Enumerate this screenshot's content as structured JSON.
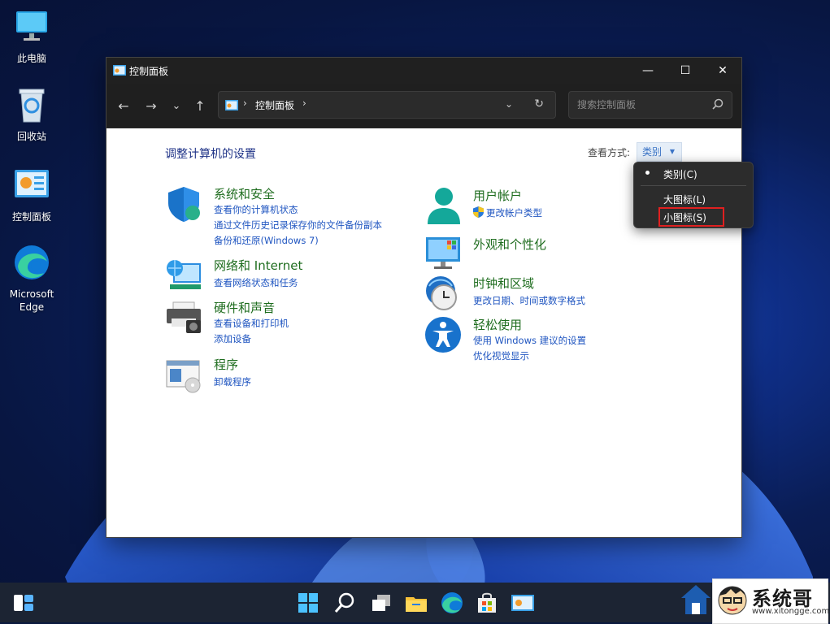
{
  "desktop": {
    "icons": [
      {
        "label": "此电脑"
      },
      {
        "label": "回收站"
      },
      {
        "label": "控制面板"
      },
      {
        "label": "Microsoft Edge"
      }
    ]
  },
  "window": {
    "title": "控制面板",
    "buttons": {
      "minimize": "—",
      "maximize": "☐",
      "close": "✕"
    },
    "nav": {
      "back": "←",
      "forward": "→",
      "recent": "⌄",
      "up": "↑"
    },
    "address": {
      "separator": "›",
      "path": "控制面板",
      "trailing": "›",
      "dropdown": "⌄",
      "refresh": "↻"
    },
    "search": {
      "placeholder": "搜索控制面板"
    }
  },
  "content": {
    "page_title": "调整计算机的设置",
    "view_by_label": "查看方式:",
    "view_by_value": "类别",
    "view_by_caret": "▼",
    "categories": [
      {
        "title": "系统和安全",
        "icon": "shield-icon",
        "links": [
          "查看你的计算机状态",
          "通过文件历史记录保存你的文件备份副本",
          "备份和还原(Windows 7)"
        ]
      },
      {
        "title": "网络和 Internet",
        "icon": "network-icon",
        "links": [
          "查看网络状态和任务"
        ]
      },
      {
        "title": "硬件和声音",
        "icon": "printer-icon",
        "links": [
          "查看设备和打印机",
          "添加设备"
        ]
      },
      {
        "title": "程序",
        "icon": "programs-icon",
        "links": [
          "卸载程序"
        ]
      },
      {
        "title": "用户帐户",
        "icon": "user-icon",
        "links": [
          "更改帐户类型"
        ]
      },
      {
        "title": "外观和个性化",
        "icon": "monitor-icon",
        "links": []
      },
      {
        "title": "时钟和区域",
        "icon": "clock-icon",
        "links": [
          "更改日期、时间或数字格式"
        ]
      },
      {
        "title": "轻松使用",
        "icon": "accessibility-icon",
        "links": [
          "使用 Windows 建议的设置",
          "优化视觉显示"
        ]
      }
    ]
  },
  "menu": {
    "items": [
      "类别(C)",
      "大图标(L)",
      "小图标(S)"
    ],
    "selected": "类别(C)"
  },
  "brand": {
    "name": "系统哥",
    "url": "www.xitongge.com"
  },
  "colors": {
    "link": "#1f55c0",
    "category_title": "#1f6d1f",
    "highlight": "#e02020"
  }
}
